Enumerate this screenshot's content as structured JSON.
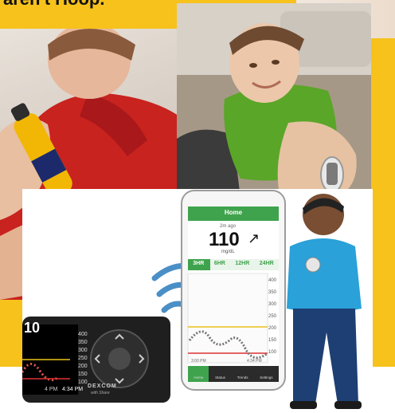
{
  "header": {
    "title": "aren't Hoop."
  },
  "dexcom_receiver": {
    "reading": "10",
    "axis_ticks": [
      "400",
      "350",
      "300",
      "250",
      "200",
      "150",
      "100"
    ],
    "time_labels": [
      "4 PM",
      "4:34 PM"
    ],
    "brand": "DEXCOM",
    "brand_sub": "with Share"
  },
  "phone_app": {
    "header_title": "Home",
    "time_ago": "2m ago",
    "glucose_value": "110",
    "glucose_unit": "mg/dL",
    "range_tabs": [
      "3HR",
      "6HR",
      "12HR",
      "24HR"
    ],
    "axis_ticks": [
      "400",
      "350",
      "300",
      "250",
      "200",
      "150",
      "100"
    ],
    "time_labels": [
      "3:00 PM",
      "4:34 PM"
    ],
    "nav_items": [
      "Home",
      "Status",
      "Trends",
      "Settings"
    ]
  }
}
